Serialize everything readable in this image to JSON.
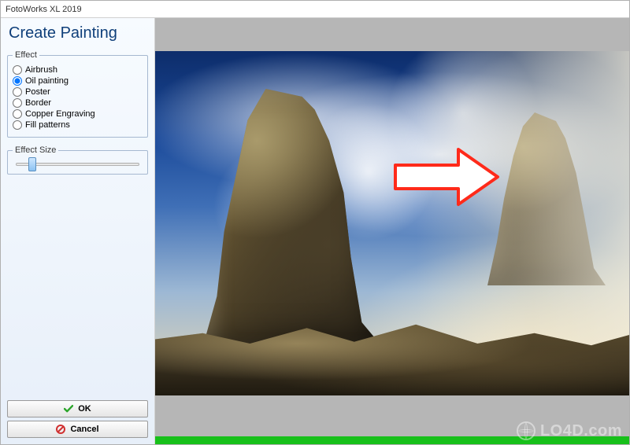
{
  "window": {
    "title": "FotoWorks XL 2019"
  },
  "sidebar": {
    "heading": "Create Painting",
    "effect_group_label": "Effect",
    "effects": [
      {
        "label": "Airbrush",
        "selected": false
      },
      {
        "label": "Oil painting",
        "selected": true
      },
      {
        "label": "Poster",
        "selected": false
      },
      {
        "label": "Border",
        "selected": false
      },
      {
        "label": "Copper Engraving",
        "selected": false
      },
      {
        "label": "Fill patterns",
        "selected": false
      }
    ],
    "size_group_label": "Effect Size",
    "size_value": 10,
    "size_min": 0,
    "size_max": 100
  },
  "buttons": {
    "ok": "OK",
    "cancel": "Cancel"
  },
  "progress": {
    "percent": 100
  },
  "watermark": {
    "text": "LO4D.com"
  },
  "preview": {
    "arrow_icon": "arrow-right-icon"
  }
}
